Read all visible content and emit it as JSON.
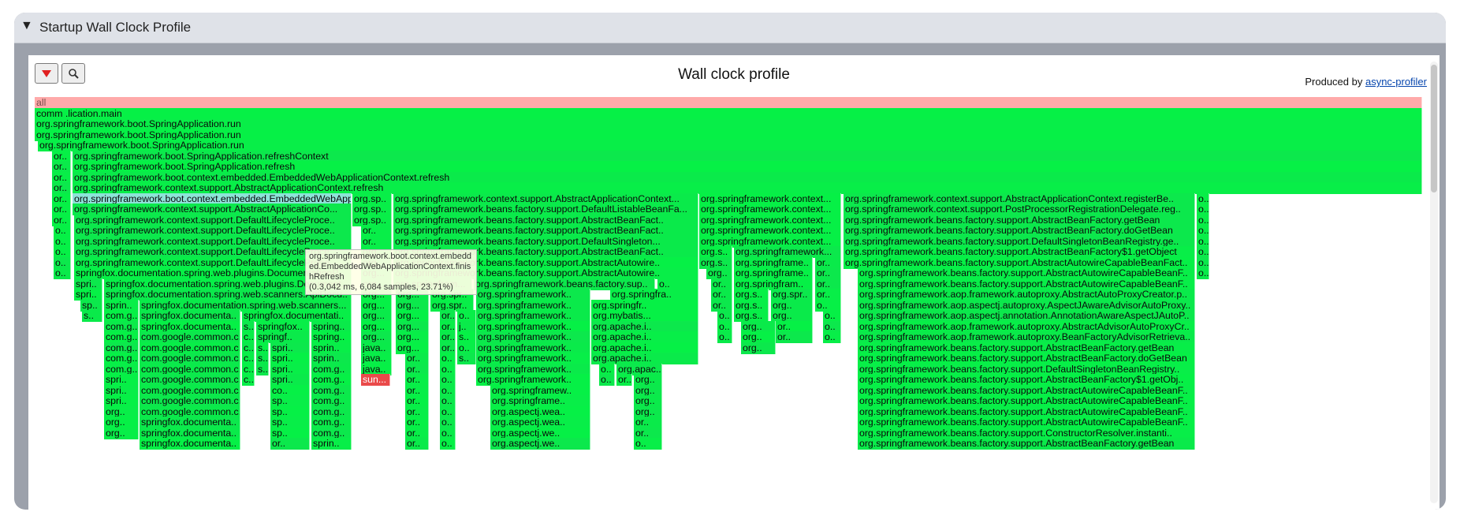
{
  "panel": {
    "toggle_icon": "▼",
    "title": "Startup Wall Clock Profile"
  },
  "toolbar": {
    "reverse_icon": "red-down-triangle-icon",
    "search_icon": "magnifier-icon"
  },
  "profile": {
    "title": "Wall clock profile",
    "produced_by": "Produced by ",
    "profiler_link": "async-profiler"
  },
  "tooltip": {
    "name": "org.springframework.boot.context.embedded.EmbeddedWebApplicationContext.finishRefresh",
    "stats": "(0.3,042 ms, 6,084 samples, 23.71%)"
  },
  "colors": {
    "root": "#ffaaaa",
    "frame": "#08ee48",
    "highlight": "#8de3d8",
    "selected": "#ea4a4a"
  },
  "frames": [
    [
      0,
      0,
      1760,
      "all",
      "root"
    ],
    [
      1,
      0,
      1760,
      "comm                              .lication.main"
    ],
    [
      2,
      0,
      1760,
      "org.springframework.boot.SpringApplication.run"
    ],
    [
      3,
      0,
      1760,
      "org.springframework.boot.SpringApplication.run"
    ],
    [
      4,
      4,
      1756,
      "org.springframework.boot.SpringApplication.run"
    ],
    [
      5,
      22,
      24,
      "or.."
    ],
    [
      5,
      48,
      1712,
      "org.springframework.boot.SpringApplication.refreshContext"
    ],
    [
      6,
      22,
      24,
      "or.."
    ],
    [
      6,
      48,
      1712,
      "org.springframework.boot.SpringApplication.refresh"
    ],
    [
      7,
      22,
      24,
      "or.."
    ],
    [
      7,
      48,
      1712,
      "org.springframework.boot.context.embedded.EmbeddedWebApplicationContext.refresh"
    ],
    [
      8,
      22,
      24,
      "or.."
    ],
    [
      8,
      48,
      1712,
      "org.springframework.context.support.AbstractApplicationContext.refresh"
    ],
    [
      9,
      22,
      24,
      "or.."
    ],
    [
      9,
      48,
      354,
      "org.springframework.boot.context.embedded.EmbeddedWebApplicat",
      "highlight"
    ],
    [
      9,
      403,
      50,
      "org.sp.."
    ],
    [
      9,
      455,
      387,
      "org.springframework.context.support.AbstractApplicationContext..."
    ],
    [
      9,
      843,
      180,
      "org.springframework.context..."
    ],
    [
      9,
      1026,
      446,
      "org.springframework.context.support.AbstractApplicationContext.registerBe.."
    ],
    [
      9,
      1474,
      16,
      "o.."
    ],
    [
      10,
      22,
      24,
      "or.."
    ],
    [
      10,
      48,
      354,
      "org.springframework.context.support.AbstractApplicationCo..."
    ],
    [
      10,
      403,
      50,
      "org.sp.."
    ],
    [
      10,
      455,
      387,
      "org.springframework.beans.factory.support.DefaultListableBeanFa..."
    ],
    [
      10,
      843,
      180,
      "org.springframework.context..."
    ],
    [
      10,
      1026,
      446,
      "org.springframework.context.support.PostProcessorRegistrationDelegate.reg.."
    ],
    [
      10,
      1474,
      16,
      "o.."
    ],
    [
      11,
      22,
      24,
      "or.."
    ],
    [
      11,
      50,
      352,
      "org.springframework.context.support.DefaultLifecycleProce.."
    ],
    [
      11,
      403,
      50,
      "org.sp.."
    ],
    [
      11,
      455,
      387,
      "org.springframework.beans.factory.support.AbstractBeanFact.."
    ],
    [
      11,
      843,
      180,
      "org.springframework.context..."
    ],
    [
      11,
      1026,
      446,
      "org.springframework.beans.factory.support.AbstractBeanFactory.getBean"
    ],
    [
      11,
      1474,
      16,
      "o.."
    ],
    [
      12,
      24,
      22,
      "o.."
    ],
    [
      12,
      50,
      352,
      "org.springframework.context.support.DefaultLifecycleProce.."
    ],
    [
      12,
      414,
      39,
      "or.."
    ],
    [
      12,
      455,
      387,
      "org.springframework.beans.factory.support.AbstractBeanFact.."
    ],
    [
      12,
      843,
      180,
      "org.springframework.context..."
    ],
    [
      12,
      1026,
      446,
      "org.springframework.beans.factory.support.AbstractBeanFactory.doGetBean"
    ],
    [
      12,
      1474,
      16,
      "o.."
    ],
    [
      13,
      24,
      22,
      "o.."
    ],
    [
      13,
      50,
      352,
      "org.springframework.context.support.DefaultLifecycleProce.."
    ],
    [
      13,
      414,
      39,
      "or.."
    ],
    [
      13,
      455,
      387,
      "org.springframework.beans.factory.support.DefaultSingleton..."
    ],
    [
      13,
      843,
      180,
      "org.springframework.context..."
    ],
    [
      13,
      1026,
      446,
      "org.springframework.beans.factory.support.DefaultSingletonBeanRegistry.ge.."
    ],
    [
      13,
      1474,
      16,
      "o.."
    ],
    [
      14,
      24,
      22,
      "o.."
    ],
    [
      14,
      50,
      352,
      "org.springframework.context.support.DefaultLifecycleProce.."
    ],
    [
      14,
      414,
      39,
      "org..."
    ],
    [
      14,
      455,
      387,
      "org.springframework.beans.factory.support.AbstractBeanFact.."
    ],
    [
      14,
      843,
      42,
      "org.s.."
    ],
    [
      14,
      887,
      136,
      "org.springframework..."
    ],
    [
      14,
      1026,
      446,
      "org.springframework.beans.factory.support.AbstractBeanFactory$1.getObject"
    ],
    [
      14,
      1474,
      16,
      "o.."
    ],
    [
      15,
      24,
      22,
      "o.."
    ],
    [
      15,
      50,
      352,
      "org.springframework.context.support.DefaultLifecycleProce.."
    ],
    [
      15,
      414,
      39,
      "org..."
    ],
    [
      15,
      455,
      387,
      "org.springframework.beans.factory.support.AbstractAutowire.."
    ],
    [
      15,
      843,
      42,
      "org.s.."
    ],
    [
      15,
      887,
      100,
      "org.springframe.."
    ],
    [
      15,
      990,
      33,
      "or.."
    ],
    [
      15,
      1026,
      446,
      "org.springframework.beans.factory.support.AbstractAutowireCapableBeanFact.."
    ],
    [
      15,
      1474,
      16,
      "o.."
    ],
    [
      16,
      24,
      22,
      "o.."
    ],
    [
      16,
      50,
      352,
      "springfox.documentation.spring.web.plugins.DocumentationP.."
    ],
    [
      16,
      414,
      39,
      "org..."
    ],
    [
      16,
      455,
      387,
      "org.springframework.beans.factory.support.AbstractAutowire.."
    ],
    [
      16,
      852,
      33,
      "org.."
    ],
    [
      16,
      887,
      100,
      "org.springframe.."
    ],
    [
      16,
      990,
      33,
      "or.."
    ],
    [
      16,
      1044,
      428,
      "org.springframework.beans.factory.support.AbstractAutowireCapableBeanF.."
    ],
    [
      16,
      1474,
      16,
      "o.."
    ],
    [
      17,
      50,
      36,
      "spri.."
    ],
    [
      17,
      88,
      314,
      "springfox.documentation.spring.web.plugins.Document.."
    ],
    [
      17,
      414,
      39,
      "org..."
    ],
    [
      17,
      455,
      100,
      "org.springfram..."
    ],
    [
      17,
      557,
      230,
      "org.springframework.beans.factory.sup.."
    ],
    [
      17,
      790,
      52,
      "o.."
    ],
    [
      17,
      858,
      27,
      "or.."
    ],
    [
      17,
      887,
      100,
      "org.springfram.."
    ],
    [
      17,
      990,
      33,
      "or.."
    ],
    [
      17,
      1044,
      428,
      "org.springframework.beans.factory.support.AbstractAutowireCapableBeanF.."
    ],
    [
      18,
      50,
      36,
      "spri.."
    ],
    [
      18,
      88,
      314,
      "springfox.documentation.spring.web.scanners.ApiDocu.."
    ],
    [
      18,
      414,
      39,
      "org..."
    ],
    [
      18,
      458,
      42,
      "org..."
    ],
    [
      18,
      502,
      55,
      "org.spr.."
    ],
    [
      18,
      560,
      145,
      "org.springframework.."
    ],
    [
      18,
      730,
      112,
      "org.springfra.."
    ],
    [
      18,
      858,
      27,
      "or.."
    ],
    [
      18,
      887,
      44,
      "org.s.."
    ],
    [
      18,
      934,
      53,
      "org.spr.."
    ],
    [
      18,
      990,
      33,
      "or.."
    ],
    [
      18,
      1044,
      428,
      "org.springframework.aop.framework.autoproxy.AbstractAutoProxyCreator.p.."
    ],
    [
      19,
      58,
      28,
      "sp.."
    ],
    [
      19,
      88,
      44,
      "sprin.."
    ],
    [
      19,
      133,
      269,
      "springfox.documentation.spring.web.scanners..."
    ],
    [
      19,
      414,
      39,
      "org..."
    ],
    [
      19,
      458,
      42,
      "org..."
    ],
    [
      19,
      502,
      55,
      "org.spr.."
    ],
    [
      19,
      560,
      145,
      "org.springframework.."
    ],
    [
      19,
      706,
      136,
      "org.springfr.."
    ],
    [
      19,
      858,
      27,
      "or.."
    ],
    [
      19,
      887,
      44,
      "org.s.."
    ],
    [
      19,
      934,
      53,
      "org.."
    ],
    [
      19,
      990,
      33,
      "o.."
    ],
    [
      19,
      1044,
      428,
      "org.springframework.aop.aspectj.autoproxy.AspectJAwareAdvisorAutoProxy.."
    ],
    [
      20,
      60,
      26,
      "s.."
    ],
    [
      20,
      88,
      44,
      "com.g.."
    ],
    [
      20,
      133,
      128,
      "springfox.documenta.."
    ],
    [
      20,
      263,
      139,
      "springfox.documentati.."
    ],
    [
      20,
      414,
      39,
      "org..."
    ],
    [
      20,
      458,
      42,
      "org..."
    ],
    [
      20,
      514,
      20,
      "or.."
    ],
    [
      20,
      536,
      24,
      "o.."
    ],
    [
      20,
      560,
      145,
      "org.springframework.."
    ],
    [
      20,
      706,
      136,
      "org.mybatis..."
    ],
    [
      20,
      866,
      19,
      "o.."
    ],
    [
      20,
      887,
      44,
      "org.s.."
    ],
    [
      20,
      934,
      53,
      "org.."
    ],
    [
      20,
      1000,
      23,
      "o.."
    ],
    [
      20,
      1044,
      428,
      "org.springframework.aop.aspectj.annotation.AnnotationAwareAspectJAutoP.."
    ],
    [
      21,
      88,
      44,
      "com.g.."
    ],
    [
      21,
      133,
      128,
      "springfox.documenta.."
    ],
    [
      21,
      263,
      16,
      "s.."
    ],
    [
      21,
      281,
      68,
      "springfox.."
    ],
    [
      21,
      351,
      51,
      "spring.."
    ],
    [
      21,
      414,
      39,
      "org..."
    ],
    [
      21,
      458,
      42,
      "org..."
    ],
    [
      21,
      514,
      20,
      "or.."
    ],
    [
      21,
      536,
      24,
      "j.."
    ],
    [
      21,
      560,
      145,
      "org.springframework.."
    ],
    [
      21,
      706,
      136,
      "org.apache.i.."
    ],
    [
      21,
      866,
      19,
      "o.."
    ],
    [
      21,
      896,
      44,
      "org.."
    ],
    [
      21,
      940,
      47,
      "or.."
    ],
    [
      21,
      1000,
      23,
      "o.."
    ],
    [
      21,
      1044,
      428,
      "org.springframework.aop.framework.autoproxy.AbstractAdvisorAutoProxyCr.."
    ],
    [
      22,
      88,
      44,
      "com.g.."
    ],
    [
      22,
      133,
      128,
      "com.google.common.c..."
    ],
    [
      22,
      263,
      16,
      "c.."
    ],
    [
      22,
      281,
      68,
      "springf.."
    ],
    [
      22,
      351,
      51,
      "spring.."
    ],
    [
      22,
      414,
      39,
      "org..."
    ],
    [
      22,
      458,
      42,
      "org..."
    ],
    [
      22,
      514,
      20,
      "or.."
    ],
    [
      22,
      536,
      24,
      "s.."
    ],
    [
      22,
      560,
      145,
      "org.springframework.."
    ],
    [
      22,
      706,
      136,
      "org.apache.i.."
    ],
    [
      22,
      866,
      19,
      "o.."
    ],
    [
      22,
      896,
      44,
      "org.."
    ],
    [
      22,
      940,
      47,
      "or.."
    ],
    [
      22,
      1000,
      23,
      "o.."
    ],
    [
      22,
      1044,
      428,
      "org.springframework.aop.framework.autoproxy.BeanFactoryAdvisorRetrieva.."
    ],
    [
      23,
      88,
      44,
      "com.g.."
    ],
    [
      23,
      133,
      128,
      "com.google.common.c..."
    ],
    [
      23,
      263,
      16,
      "c.."
    ],
    [
      23,
      281,
      16,
      "s.."
    ],
    [
      23,
      299,
      50,
      "spri.."
    ],
    [
      23,
      351,
      51,
      "sprin.."
    ],
    [
      23,
      414,
      39,
      "java.."
    ],
    [
      23,
      458,
      42,
      "org..."
    ],
    [
      23,
      514,
      20,
      "or.."
    ],
    [
      23,
      536,
      24,
      "o.."
    ],
    [
      23,
      560,
      145,
      "org.springframework.."
    ],
    [
      23,
      706,
      136,
      "org.apache.i.."
    ],
    [
      23,
      896,
      44,
      "org.."
    ],
    [
      23,
      1044,
      428,
      "org.springframework.beans.factory.support.AbstractBeanFactory.getBean"
    ],
    [
      24,
      88,
      44,
      "com.g.."
    ],
    [
      24,
      133,
      128,
      "com.google.common.c..."
    ],
    [
      24,
      263,
      16,
      "c.."
    ],
    [
      24,
      281,
      16,
      "s.."
    ],
    [
      24,
      299,
      50,
      "spri.."
    ],
    [
      24,
      351,
      51,
      "sprin.."
    ],
    [
      24,
      414,
      39,
      "java.."
    ],
    [
      24,
      470,
      30,
      "or.."
    ],
    [
      24,
      514,
      20,
      "o.."
    ],
    [
      24,
      536,
      24,
      "s.."
    ],
    [
      24,
      560,
      145,
      "org.springframework.."
    ],
    [
      24,
      706,
      136,
      "org.apache.i.."
    ],
    [
      24,
      1044,
      428,
      "org.springframework.beans.factory.support.AbstractBeanFactory.doGetBean"
    ],
    [
      25,
      88,
      44,
      "com.g.."
    ],
    [
      25,
      133,
      128,
      "com.google.common.c..."
    ],
    [
      25,
      263,
      16,
      "c.."
    ],
    [
      25,
      281,
      16,
      "s.."
    ],
    [
      25,
      299,
      50,
      "spri.."
    ],
    [
      25,
      351,
      51,
      "com.g.."
    ],
    [
      25,
      414,
      39,
      "java.."
    ],
    [
      25,
      470,
      30,
      "or.."
    ],
    [
      25,
      514,
      20,
      "o.."
    ],
    [
      25,
      560,
      145,
      "org.springframework.."
    ],
    [
      25,
      716,
      20,
      "o.."
    ],
    [
      25,
      738,
      58,
      "org.apac.."
    ],
    [
      25,
      1044,
      428,
      "org.springframework.beans.factory.support.DefaultSingletonBeanRegistry.."
    ],
    [
      26,
      88,
      44,
      "spri.."
    ],
    [
      26,
      133,
      128,
      "com.google.common.c..."
    ],
    [
      26,
      263,
      16,
      "c.."
    ],
    [
      26,
      299,
      50,
      "spri.."
    ],
    [
      26,
      351,
      51,
      "com.g.."
    ],
    [
      26,
      414,
      37,
      "sun...",
      "selected"
    ],
    [
      26,
      470,
      30,
      "or.."
    ],
    [
      26,
      514,
      20,
      "o.."
    ],
    [
      26,
      560,
      145,
      "org.springframework.."
    ],
    [
      26,
      716,
      20,
      "o.."
    ],
    [
      26,
      738,
      20,
      "or.."
    ],
    [
      26,
      760,
      36,
      "org.."
    ],
    [
      26,
      1044,
      428,
      "org.springframework.beans.factory.support.AbstractBeanFactory$1.getObj.."
    ],
    [
      27,
      88,
      44,
      "spri.."
    ],
    [
      27,
      133,
      128,
      "com.google.common.c..."
    ],
    [
      27,
      299,
      50,
      "co.."
    ],
    [
      27,
      351,
      51,
      "com.g.."
    ],
    [
      27,
      470,
      30,
      "or.."
    ],
    [
      27,
      514,
      20,
      "o.."
    ],
    [
      27,
      578,
      127,
      "org.springframew.."
    ],
    [
      27,
      760,
      36,
      "org.."
    ],
    [
      27,
      1044,
      428,
      "org.springframework.beans.factory.support.AbstractAutowireCapableBeanF.."
    ],
    [
      28,
      88,
      44,
      "spri.."
    ],
    [
      28,
      133,
      128,
      "com.google.common.c..."
    ],
    [
      28,
      299,
      50,
      "sp.."
    ],
    [
      28,
      351,
      51,
      "com.g.."
    ],
    [
      28,
      470,
      30,
      "or.."
    ],
    [
      28,
      514,
      20,
      "o.."
    ],
    [
      28,
      578,
      127,
      "org.springframe.."
    ],
    [
      28,
      760,
      36,
      "org.."
    ],
    [
      28,
      1044,
      428,
      "org.springframework.beans.factory.support.AbstractAutowireCapableBeanF.."
    ],
    [
      29,
      88,
      44,
      "org.."
    ],
    [
      29,
      133,
      128,
      "com.google.common.c..."
    ],
    [
      29,
      299,
      50,
      "sp.."
    ],
    [
      29,
      351,
      51,
      "com.g.."
    ],
    [
      29,
      470,
      30,
      "or.."
    ],
    [
      29,
      514,
      20,
      "o.."
    ],
    [
      29,
      578,
      127,
      "org.aspectj.wea.."
    ],
    [
      29,
      760,
      36,
      "org.."
    ],
    [
      29,
      1044,
      428,
      "org.springframework.beans.factory.support.AbstractAutowireCapableBeanF.."
    ],
    [
      30,
      88,
      44,
      "org.."
    ],
    [
      30,
      133,
      128,
      "springfox.documenta.."
    ],
    [
      30,
      299,
      50,
      "sp.."
    ],
    [
      30,
      351,
      51,
      "com.g.."
    ],
    [
      30,
      470,
      30,
      "or.."
    ],
    [
      30,
      514,
      20,
      "o.."
    ],
    [
      30,
      578,
      127,
      "org.aspectj.wea.."
    ],
    [
      30,
      760,
      36,
      "or.."
    ],
    [
      30,
      1044,
      428,
      "org.springframework.beans.factory.support.AbstractAutowireCapableBeanF.."
    ],
    [
      31,
      88,
      44,
      "org.."
    ],
    [
      31,
      133,
      128,
      "springfox.documenta.."
    ],
    [
      31,
      299,
      50,
      "sp.."
    ],
    [
      31,
      351,
      51,
      "com.g.."
    ],
    [
      31,
      470,
      30,
      "or.."
    ],
    [
      31,
      514,
      20,
      "o.."
    ],
    [
      31,
      578,
      127,
      "org.aspectj.we.."
    ],
    [
      31,
      760,
      36,
      "or.."
    ],
    [
      31,
      1044,
      428,
      "org.springframework.beans.factory.support.ConstructorResolver.instanti.."
    ],
    [
      32,
      133,
      128,
      "springfox.documenta.."
    ],
    [
      32,
      299,
      50,
      "or.."
    ],
    [
      32,
      351,
      51,
      "sprin.."
    ],
    [
      32,
      470,
      30,
      "or.."
    ],
    [
      32,
      514,
      20,
      "o.."
    ],
    [
      32,
      578,
      127,
      "org.aspectj.we.."
    ],
    [
      32,
      760,
      36,
      "o.."
    ],
    [
      32,
      1044,
      428,
      "org.springframework.beans.factory.support.AbstractBeanFactory.getBean"
    ]
  ]
}
